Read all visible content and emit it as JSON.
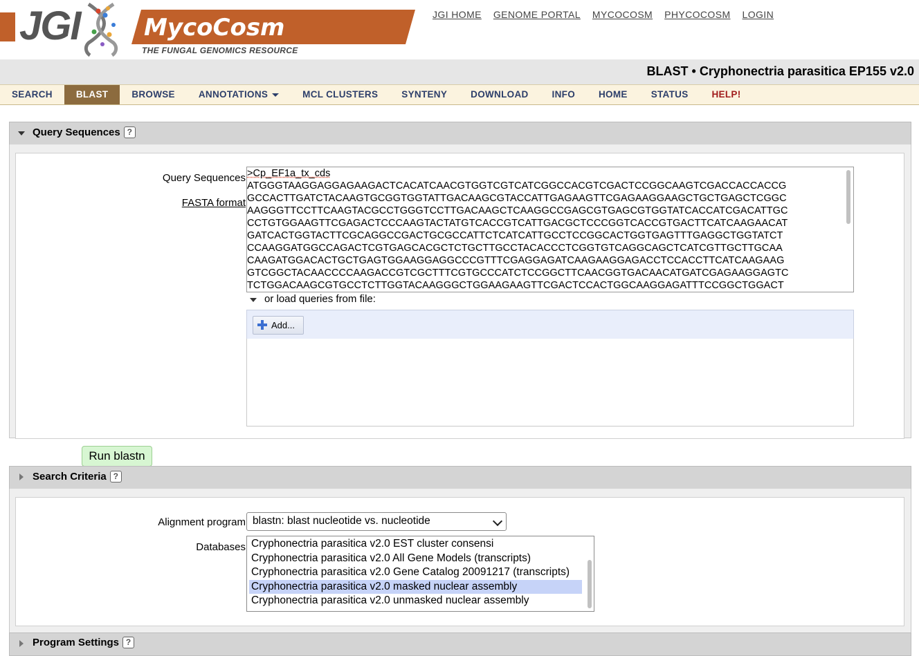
{
  "header": {
    "jgi_logo": "JGI",
    "brand_title": "MycoCosm",
    "brand_subtitle": "THE FUNGAL GENOMICS RESOURCE",
    "links": [
      "JGI HOME",
      "GENOME PORTAL",
      "MYCOCOSM",
      "PHYCOCOSM",
      "LOGIN"
    ]
  },
  "page_title": "BLAST • Cryphonectria parasitica EP155 v2.0",
  "nav": {
    "items": [
      "SEARCH",
      "BLAST",
      "BROWSE",
      "ANNOTATIONS",
      "MCL CLUSTERS",
      "SYNTENY",
      "DOWNLOAD",
      "INFO",
      "HOME",
      "STATUS",
      "HELP!"
    ],
    "active": "BLAST"
  },
  "query_panel": {
    "title": "Query Sequences",
    "help_icon": "?",
    "label": "Query Sequences",
    "fasta_link": "FASTA format",
    "sequence_lines": [
      ">Cp_EF1a_tx_cds",
      "ATGGGTAAGGAGGAGAAGACTCACATCAACGTGGTCGTCATCGGCCACGTCGACTCCGGCAAGTCGACCACCACCG",
      "GCCACTTGATCTACAAGTGCGGTGGTATTGACAAGCGTACCATTGAGAAGTTCGAGAAGGAAGCTGCTGAGCTCGGC",
      "AAGGGTTCCTTCAAGTACGCCTGGGTCCTTGACAAGCTCAAGGCCGAGCGTGAGCGTGGTATCACCATCGACATTGC",
      "CCTGTGGAAGTTCGAGACTCCCAAGTACTATGTCACCGTCATTGACGCTCCCGGTCACCGTGACTTCATCAAGAACAT",
      "GATCACTGGTACTTCGCAGGCCGACTGCGCCATTCTCATCATTGCCTCCGGCACTGGTGAGTTTGAGGCTGGTATCT",
      "CCAAGGATGGCCAGACTCGTGAGCACGCTCTGCTTGCCTACACCCTCGGTGTCAGGCAGCTCATCGTTGCTTGCAA",
      "CAAGATGGACACTGCTGAGTGGAAGGAGGCCCGTTTCGAGGAGATCAAGAAGGAGACCTCCACCTTCATCAAGAAG",
      "GTCGGCTACAACCCCAAGACCGTCGCTTTCGTGCCCATCTCCGGCTTCAACGGTGACAACATGATCGAGAAGGAGTC",
      "TCTGGACAAGCGTGCCTCTTGGTACAAGGGCTGGAAGAAGTTCGACTCCACTGGCAAGGAGATTTCCGGCTGGACT"
    ],
    "load_label": "or load queries from file:",
    "add_button": "Add..."
  },
  "run_button": "Run blastn",
  "search_panel": {
    "title": "Search Criteria",
    "help_icon": "?",
    "alignment_label": "Alignment program",
    "alignment_value": "blastn: blast nucleotide vs. nucleotide",
    "databases_label": "Databases",
    "databases": [
      "Cryphonectria parasitica v2.0 EST cluster consensi",
      "Cryphonectria parasitica v2.0 All Gene Models (transcripts)",
      "Cryphonectria parasitica v2.0 Gene Catalog 20091217 (transcripts)",
      "Cryphonectria parasitica v2.0 masked nuclear assembly",
      "Cryphonectria parasitica v2.0 unmasked nuclear assembly"
    ],
    "selected_database": "Cryphonectria parasitica v2.0 masked nuclear assembly"
  },
  "settings_panel": {
    "title": "Program Settings",
    "help_icon": "?"
  },
  "colors": {
    "brand_orange": "#c0602a",
    "nav_active": "#8c6b3e",
    "nav_text": "#2c3e6a",
    "help_red": "#a11c1c",
    "run_button_bg": "#d7f6d2"
  }
}
